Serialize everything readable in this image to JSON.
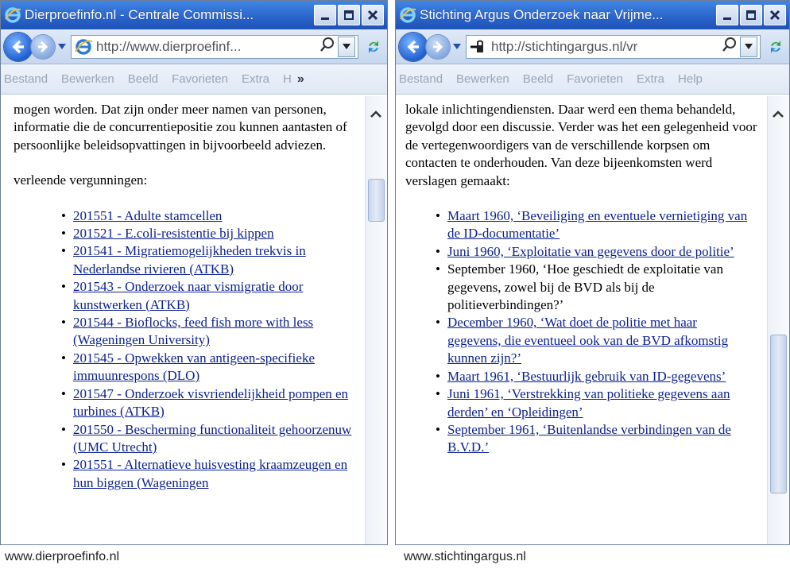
{
  "left": {
    "title": "Dierproefinfo.nl - Centrale Commissi...",
    "address": "http://www.dierproefinf...",
    "menu": [
      "Bestand",
      "Bewerken",
      "Beeld",
      "Favorieten",
      "Extra",
      "H"
    ],
    "overflow_icon": "chevron-double-right-icon",
    "intro": "mogen worden. Dat zijn onder meer namen van personen, informatie die de concurrentiepositie zou kunnen aantasten of persoonlijke beleidsopvattingen in bijvoorbeeld adviezen.",
    "heading": "verleende vergunningen:",
    "items": [
      "201551 - Adulte stamcellen",
      "201521 - E.coli-resistentie bij kippen",
      "201541 - Migratiemogelijkheden trekvis in Nederlandse rivieren (ATKB)",
      "201543 - Onderzoek naar vismigratie door kunstwerken (ATKB)",
      "201544 - Bioflocks, feed fish more with less (Wageningen University)",
      "201545 - Opwekken van antigeen-specifieke immuunrespons (DLO)",
      "201547 - Onderzoek visvriendelijkheid pompen en turbines (ATKB)",
      "201550 - Bescherming functionaliteit gehoorzenuw (UMC Utrecht)",
      "201551 - Alternatieve huisvesting kraamzeugen en hun biggen (Wageningen"
    ],
    "caption": "www.dierproefinfo.nl"
  },
  "right": {
    "title": "Stichting Argus Onderzoek naar Vrijme...",
    "address": "http://stichtingargus.nl/vr",
    "menu": [
      "Bestand",
      "Bewerken",
      "Beeld",
      "Favorieten",
      "Extra",
      "Help"
    ],
    "intro": "lokale inlichtingendiensten. Daar werd een thema behandeld, gevolgd door een discussie. Verder was het een gelegenheid voor de vertegenwoordigers van de verschillende korpsen om contacten te onderhouden. Van deze bijeenkomsten werd verslagen gemaakt:",
    "items": [
      {
        "text": "Maart 1960, ‘Beveiliging en eventuele vernietiging van de ID-documentatie’",
        "link": true
      },
      {
        "text": "Juni 1960, ‘Exploitatie van gegevens door de politie’",
        "link": true
      },
      {
        "text": "September 1960, ‘Hoe geschiedt de exploitatie van gegevens, zowel bij de BVD als bij de politieverbindingen?’",
        "link": false
      },
      {
        "text": "December 1960, ‘Wat doet de politie met haar gegevens, die eventueel ook van de BVD afkomstig kunnen zijn?’",
        "link": true
      },
      {
        "text": "Maart 1961, ‘Bestuurlijk gebruik van ID-gegevens’",
        "link": true
      },
      {
        "text": "Juni 1961, ‘Verstrekking van politieke gegevens aan derden’ en ‘Opleidingen’",
        "link": true
      },
      {
        "text": "September 1961, ‘Buitenlandse verbindingen van de B.V.D.’",
        "link": true
      }
    ],
    "caption": "www.stichtingargus.nl"
  },
  "colors": {
    "titlebar": "#2a63c9",
    "link": "#0a1f8f",
    "menu_disabled": "#9aa5b4"
  },
  "icons": [
    "ie-logo-icon",
    "back-arrow-icon",
    "forward-arrow-icon",
    "dropdown-arrow-icon",
    "search-icon",
    "refresh-icon",
    "minimize-icon",
    "maximize-icon",
    "close-icon",
    "scroll-up-icon",
    "lock-icon"
  ]
}
